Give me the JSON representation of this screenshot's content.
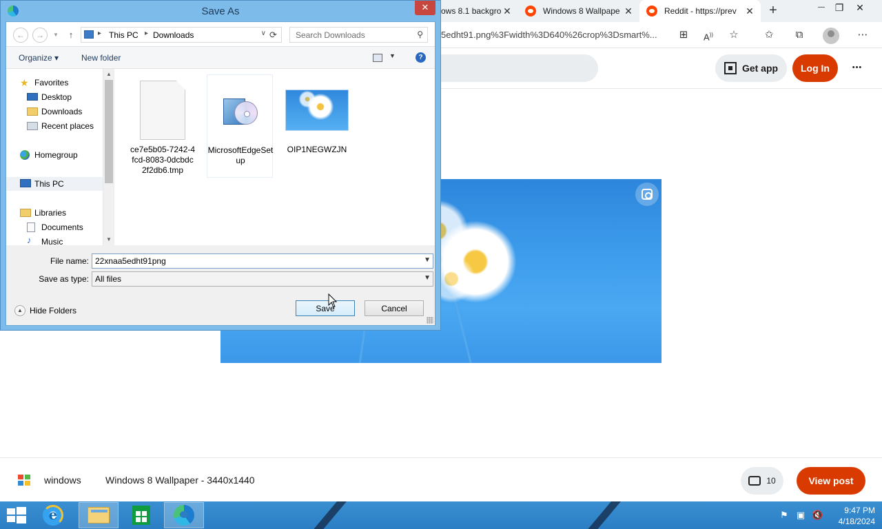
{
  "browser": {
    "tabs": [
      {
        "title": "ows 8.1 backgro",
        "close": "✕"
      },
      {
        "title": "Windows 8 Wallpape",
        "close": "✕"
      },
      {
        "title": "Reddit - https://prev",
        "close": "✕"
      }
    ],
    "new_tab": "+",
    "window_controls": {
      "minimize": "—",
      "restore": "❐",
      "close": "✕"
    },
    "url": "5edht91.png%3Fwidth%3D640%26crop%3Dsmart%...",
    "toolbar_icons": [
      "app-icon",
      "read-aloud-icon",
      "add-favorite-icon",
      "favorites-icon",
      "collections-icon",
      "profile-icon",
      "more-icon"
    ]
  },
  "reddit": {
    "get_app": "Get app",
    "log_in": "Log In",
    "more": "•••",
    "subreddit": "windows",
    "post_title": "Windows 8 Wallpaper - 3440x1440",
    "comment_count": "10",
    "view_post": "View post",
    "colors": {
      "brand": "#d93a00"
    }
  },
  "dialog": {
    "title": "Save As",
    "close": "✕",
    "breadcrumb": [
      "This PC",
      "Downloads"
    ],
    "search_placeholder": "Search Downloads",
    "organize": "Organize ▾",
    "new_folder": "New folder",
    "nav_items": [
      {
        "label": "Favorites",
        "icon": "star-icon"
      },
      {
        "label": "Desktop",
        "icon": "desktop-icon"
      },
      {
        "label": "Downloads",
        "icon": "downloads-folder-icon"
      },
      {
        "label": "Recent places",
        "icon": "recent-places-icon"
      },
      {
        "label": "Homegroup",
        "icon": "homegroup-icon"
      },
      {
        "label": "This PC",
        "icon": "computer-icon"
      },
      {
        "label": "Libraries",
        "icon": "libraries-icon"
      },
      {
        "label": "Documents",
        "icon": "documents-icon"
      },
      {
        "label": "Music",
        "icon": "music-icon"
      }
    ],
    "files": [
      {
        "name": "ce7e5b05-7242-4fcd-8083-0dcbdc2f2db6.tmp",
        "icon": "tmp-file-icon"
      },
      {
        "name": "MicrosoftEdgeSetup",
        "icon": "installer-icon"
      },
      {
        "name": "OIP1NEGWZJN",
        "icon": "image-thumbnail"
      }
    ],
    "file_name_label": "File name:",
    "file_name_value": "22xnaa5edht91png",
    "save_as_type_label": "Save as type:",
    "save_as_type_value": "All files",
    "hide_folders": "Hide Folders",
    "save": "Save",
    "cancel": "Cancel"
  },
  "taskbar": {
    "apps": [
      "internet-explorer-icon",
      "file-explorer-icon",
      "store-icon",
      "edge-icon"
    ],
    "tray": [
      "flag-icon",
      "network-icon",
      "volume-muted-icon"
    ],
    "time": "9:47 PM",
    "date": "4/18/2024"
  }
}
